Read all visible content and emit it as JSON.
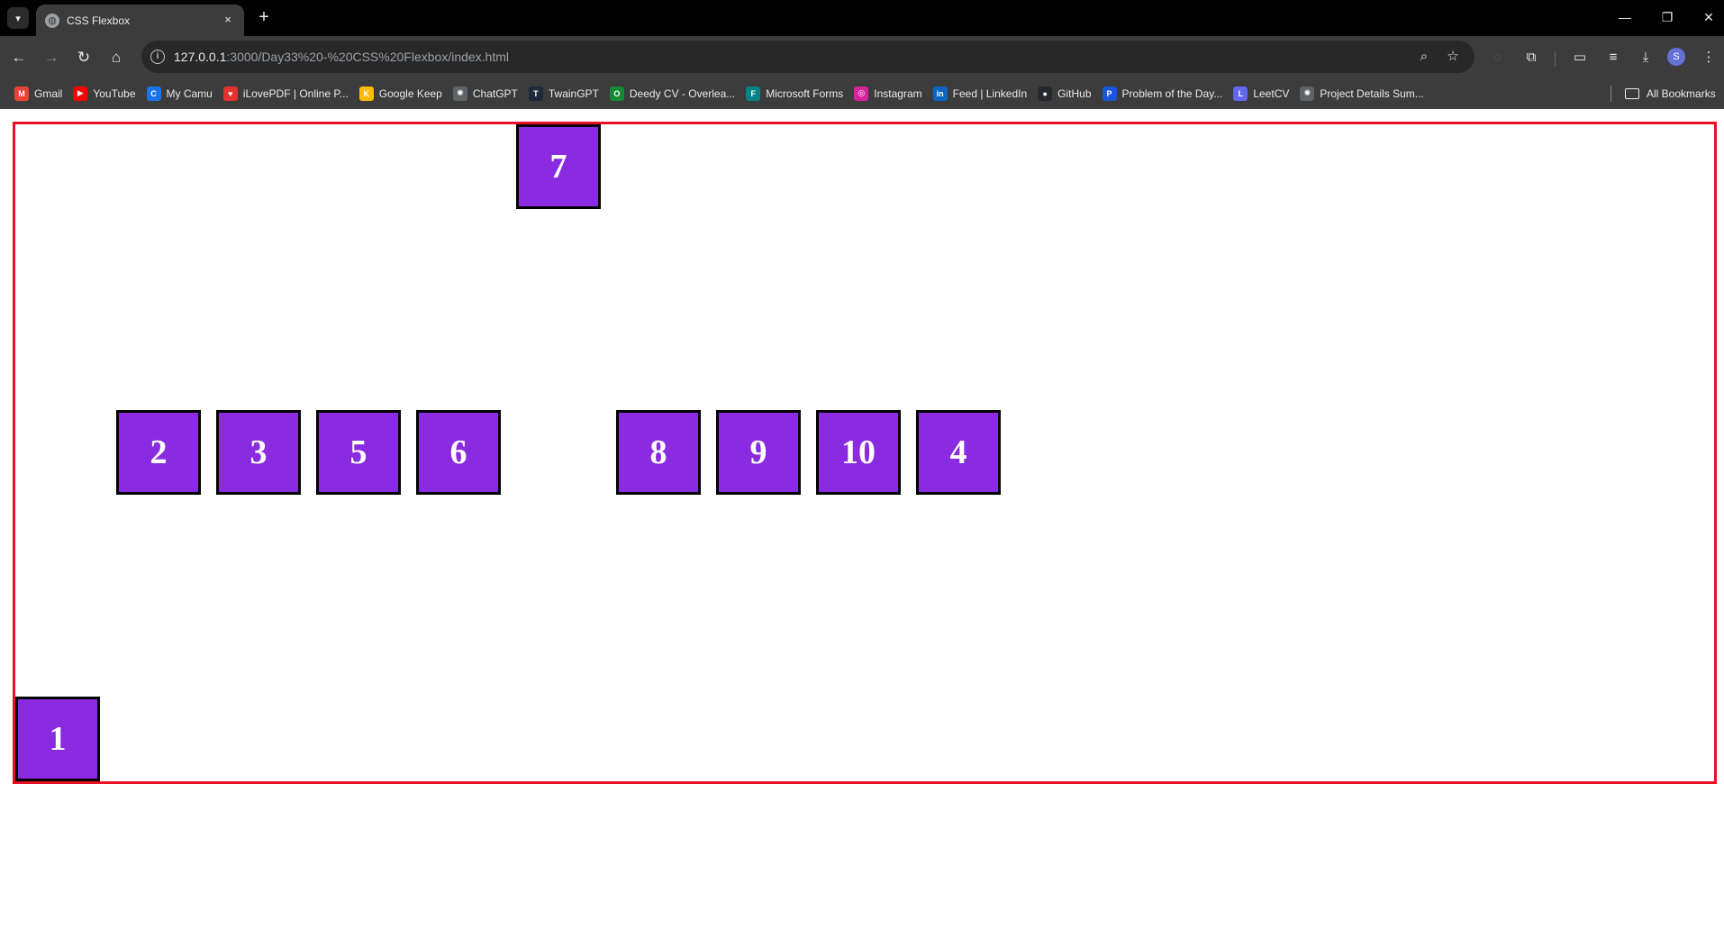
{
  "browser": {
    "tab_title": "CSS Flexbox",
    "tab_close": "×",
    "new_tab": "+",
    "url_host": "127.0.0.1",
    "url_path": ":3000/Day33%20-%20CSS%20Flexbox/index.html",
    "profile_initial": "S",
    "bookmarks": [
      {
        "label": "Gmail",
        "icon": "gmail-icon",
        "color": "#ea4335",
        "glyph": "M"
      },
      {
        "label": "YouTube",
        "icon": "youtube-icon",
        "color": "#ff0000",
        "glyph": "▶"
      },
      {
        "label": "My Camu",
        "icon": "camu-icon",
        "color": "#1a73e8",
        "glyph": "C"
      },
      {
        "label": "iLovePDF | Online P...",
        "icon": "ilovepdf-icon",
        "color": "#e5322d",
        "glyph": "♥"
      },
      {
        "label": "Google Keep",
        "icon": "google-keep-icon",
        "color": "#fbbc04",
        "glyph": "K"
      },
      {
        "label": "ChatGPT",
        "icon": "chatgpt-icon",
        "color": "#5f6368",
        "glyph": "✺"
      },
      {
        "label": "TwainGPT",
        "icon": "twaingpt-icon",
        "color": "#1f2937",
        "glyph": "T"
      },
      {
        "label": "Deedy CV - Overlea...",
        "icon": "overleaf-icon",
        "color": "#138a36",
        "glyph": "O"
      },
      {
        "label": "Microsoft Forms",
        "icon": "microsoft-forms-icon",
        "color": "#038387",
        "glyph": "F"
      },
      {
        "label": "Instagram",
        "icon": "instagram-icon",
        "color": "#d6249f",
        "glyph": "◎"
      },
      {
        "label": "Feed | LinkedIn",
        "icon": "linkedin-icon",
        "color": "#0a66c2",
        "glyph": "in"
      },
      {
        "label": "GitHub",
        "icon": "github-icon",
        "color": "#24292f",
        "glyph": "●"
      },
      {
        "label": "Problem of the Day...",
        "icon": "problem-of-day-icon",
        "color": "#1a56db",
        "glyph": "P"
      },
      {
        "label": "LeetCV",
        "icon": "leetcv-icon",
        "color": "#6366f1",
        "glyph": "L"
      },
      {
        "label": "Project Details Sum...",
        "icon": "project-details-icon",
        "color": "#5f6368",
        "glyph": "✺"
      }
    ],
    "all_bookmarks": "All Bookmarks"
  },
  "page": {
    "container_border_color": "#e81123",
    "box_color": "#8a2be2",
    "boxes": [
      "1",
      "2",
      "3",
      "5",
      "6",
      "7",
      "8",
      "9",
      "10",
      "4"
    ]
  }
}
